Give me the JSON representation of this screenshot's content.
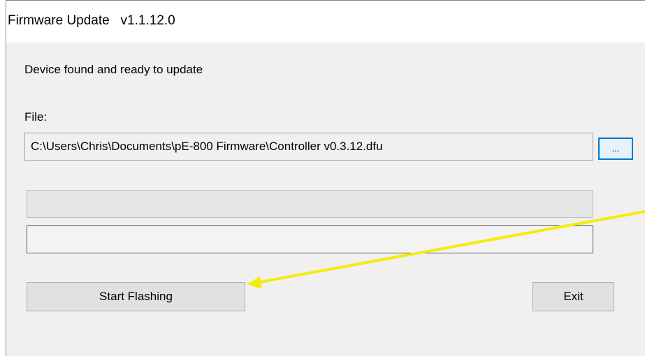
{
  "window": {
    "title": "Firmware Update   v1.1.12.0"
  },
  "status": {
    "message": "Device found and ready to update"
  },
  "file": {
    "label": "File:",
    "path": "C:\\Users\\Chris\\Documents\\pE-800 Firmware\\Controller v0.3.12.dfu",
    "browse_label": "..."
  },
  "progress": {
    "bar1_value": 0,
    "bar2_value": 0
  },
  "buttons": {
    "start_label": "Start Flashing",
    "exit_label": "Exit"
  },
  "annotation": {
    "arrow_color": "#f5ec0a"
  },
  "colors": {
    "window_bg": "#f0f0f0",
    "titlebar_bg": "#ffffff",
    "accent": "#0078d7"
  }
}
